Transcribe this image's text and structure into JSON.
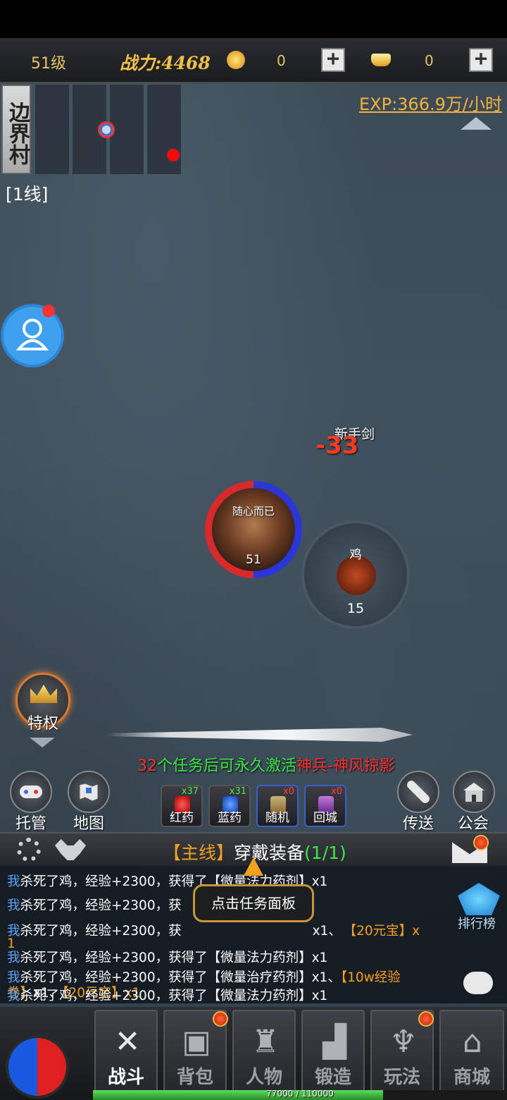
{
  "topbar": {
    "level": "51级",
    "power": "战力:4468",
    "coins": "0",
    "ingots": "0"
  },
  "minimap": {
    "name": "边界村",
    "line": "[1线]"
  },
  "exp_rate": "EXP:366.9万/小时",
  "field": {
    "item_drop": "新手剑",
    "damage": "-33",
    "player_name": "随心而已",
    "player_level": "51",
    "monster_name": "鸡",
    "monster_level": "15"
  },
  "privilege_label": "特权",
  "weapon_notice": {
    "count": "32",
    "text": "个任务后可永久激活",
    "weapon": "神兵-神风掠影"
  },
  "left_buttons": [
    {
      "label": "托管"
    },
    {
      "label": "地图"
    }
  ],
  "right_buttons": [
    {
      "label": "传送"
    },
    {
      "label": "公会"
    }
  ],
  "potions": [
    {
      "label": "红药",
      "count": "x37"
    },
    {
      "label": "蓝药",
      "count": "x31"
    },
    {
      "label": "随机",
      "count": "x0"
    },
    {
      "label": "回城",
      "count": "x0"
    }
  ],
  "quest": {
    "tag": "【主线】",
    "title": "穿戴装备",
    "progress": "(1/1)",
    "tooltip": "点击任务面板"
  },
  "ranking_label": "排行榜",
  "chat": {
    "l1_me": "我",
    "l1": "杀死了鸡，经验+2300，获得了【微量法力药剂】x1",
    "l2_me": "我",
    "l2": "杀死了鸡，经验+2300，获",
    "l3_me": "我",
    "l3a": "杀死了鸡，经验+2300，获",
    "l3b": "x1、",
    "l3c": "【20元宝】x",
    "l3d": "1",
    "l4_me": "我",
    "l4": "杀死了鸡，经验+2300，获得了【微量法力药剂】x1",
    "l5_me": "我",
    "l5a": "杀死了鸡，经验+2300，获得了【微量治疗药剂】x1、",
    "l5b": "【10w经验",
    "l6a": "卷】",
    "l6b": "x1、",
    "l6c": "【20元宝】x1",
    "l7_me": "我",
    "l7": "杀死了鸡，经验+2300，获得了【微量法力药剂】x1"
  },
  "nav": [
    {
      "label": "战斗",
      "icon": "crossed-swords-icon"
    },
    {
      "label": "背包",
      "icon": "backpack-icon"
    },
    {
      "label": "人物",
      "icon": "helmet-icon"
    },
    {
      "label": "锻造",
      "icon": "anvil-icon"
    },
    {
      "label": "玩法",
      "icon": "winged-sword-icon"
    },
    {
      "label": "商城",
      "icon": "shop-icon"
    }
  ],
  "exp_bar": {
    "text": "77000 / 110000",
    "fraction": 0.7
  },
  "colors": {
    "accent_gold": "#e9c06a",
    "me": "#5aa6ff",
    "reward": "#f3a020",
    "quest_green": "#3ee64a"
  }
}
